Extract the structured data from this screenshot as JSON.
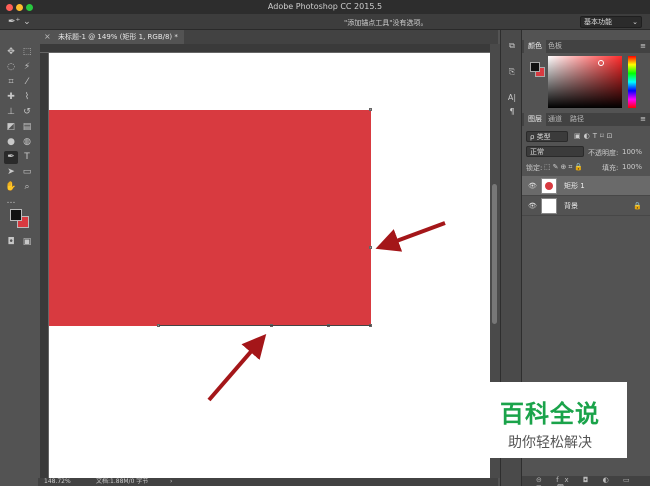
{
  "app": {
    "title": "Adobe Photoshop CC 2015.5"
  },
  "options_bar": {
    "hint": "\"添加锚点工具\"没有选项。",
    "workspace": "基本功能"
  },
  "document": {
    "tab_label": "未标题-1 @ 149% (矩形 1, RGB/8) *",
    "close_glyph": "×",
    "zoom": "148.72%",
    "doc_info": "文档:1.88M/0 字节"
  },
  "panels": {
    "color_tabs": [
      "颜色",
      "色板"
    ],
    "layer_tabs": [
      "图层",
      "通道",
      "路径"
    ],
    "kind_filter": "ρ 类型",
    "blend_mode": "正常",
    "opacity_label": "不透明度:",
    "opacity_value": "100%",
    "lock_label": "锁定:",
    "fill_label": "填充:",
    "fill_value": "100%",
    "layers": [
      {
        "name": "矩形 1",
        "selected": true
      },
      {
        "name": "背景",
        "selected": false
      }
    ]
  },
  "watermark": {
    "title": "百科全说",
    "subtitle": "助你轻松解决"
  },
  "colors": {
    "shape_fill": "#d83a40",
    "arrow": "#a41619",
    "watermark_green": "#1aa34a"
  },
  "icons": {
    "tools": [
      "move-icon",
      "marquee-icon",
      "lasso-icon",
      "magic-wand-icon",
      "crop-icon",
      "eyedropper-icon",
      "healing-brush-icon",
      "brush-icon",
      "clone-stamp-icon",
      "history-brush-icon",
      "eraser-icon",
      "gradient-icon",
      "blur-icon",
      "dodge-icon",
      "pen-icon",
      "type-icon",
      "path-select-icon",
      "rectangle-icon",
      "hand-icon",
      "zoom-icon"
    ]
  }
}
